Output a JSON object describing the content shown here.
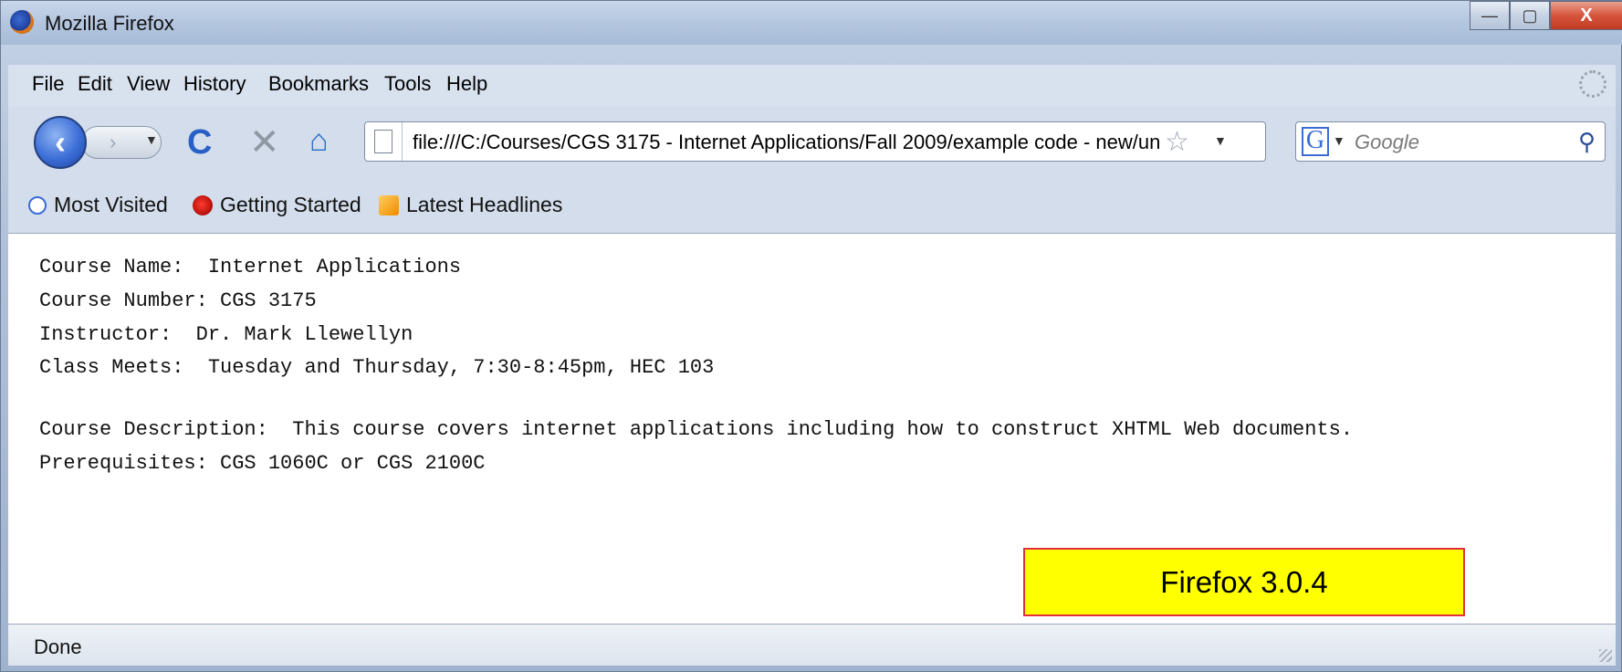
{
  "window": {
    "title": "Mozilla Firefox",
    "minimize_glyph": "—",
    "maximize_glyph": "▢",
    "close_glyph": "X"
  },
  "menubar": {
    "items": [
      "File",
      "Edit",
      "View",
      "History",
      "Bookmarks",
      "Tools",
      "Help"
    ]
  },
  "navbar": {
    "back_glyph": "‹",
    "forward_glyph": "›",
    "reload_glyph": "C",
    "stop_glyph": "✕",
    "home_glyph": "⌂",
    "url": "file:///C:/Courses/CGS 3175 - Internet Applications/Fall 2009/example code - new/un",
    "search_engine_letter": "G",
    "search_placeholder": "Google"
  },
  "bookmarks_toolbar": {
    "items": [
      {
        "label": "Most Visited",
        "icon": "most-visited-icon"
      },
      {
        "label": "Getting Started",
        "icon": "getting-started-icon"
      },
      {
        "label": "Latest Headlines",
        "icon": "rss-icon"
      }
    ]
  },
  "content": {
    "lines": [
      "Course Name:  Internet Applications",
      "Course Number: CGS 3175",
      "Instructor:  Dr. Mark Llewellyn",
      "Class Meets:  Tuesday and Thursday, 7:30-8:45pm, HEC 103",
      "Course Description:  This course covers internet applications including how to construct XHTML Web documents.",
      "Prerequisites: CGS 1060C or CGS 2100C"
    ]
  },
  "annotation": {
    "text": "Firefox 3.0.4"
  },
  "statusbar": {
    "text": "Done"
  },
  "colors": {
    "annotation_bg": "#ffff00",
    "annotation_border": "#e0303a",
    "accent_blue": "#2960c8"
  }
}
